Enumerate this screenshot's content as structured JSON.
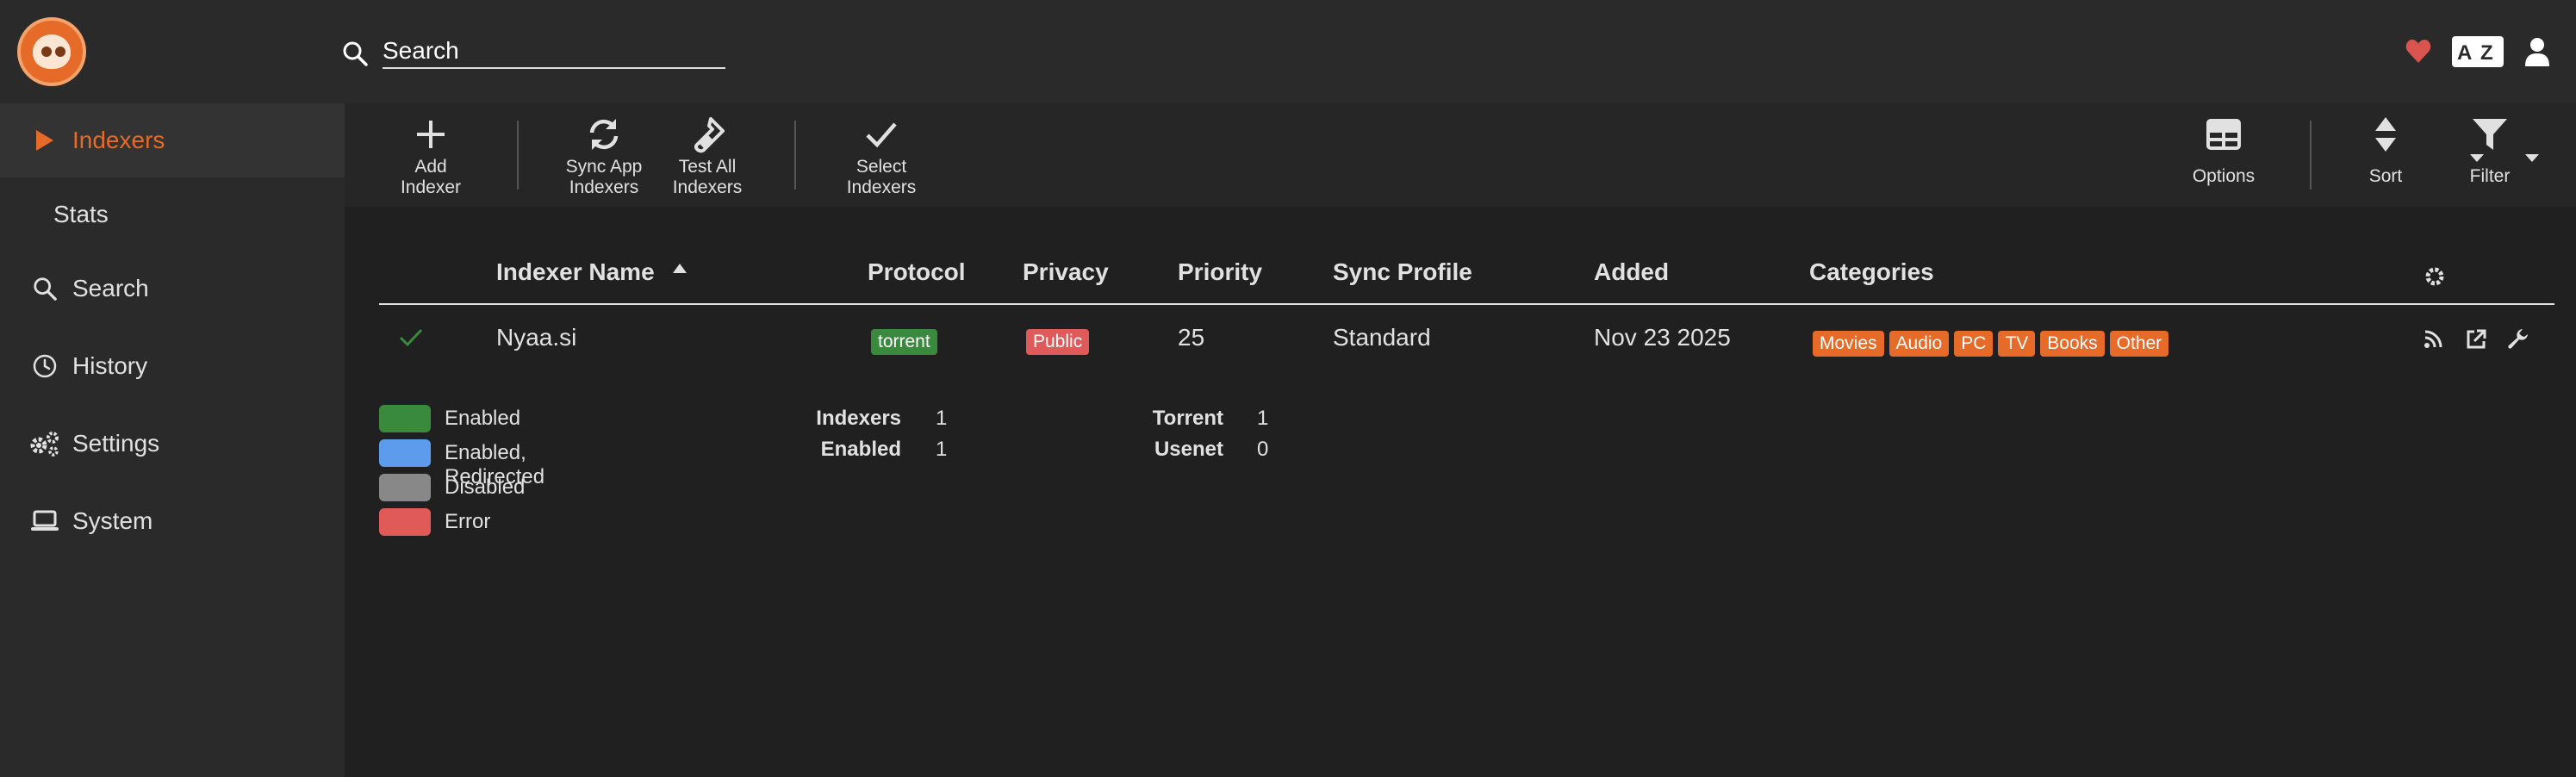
{
  "header": {
    "search_placeholder": "Search",
    "icons": [
      "heart-icon",
      "translate-icon",
      "user-icon"
    ],
    "heart_color": "#d9534f"
  },
  "sidebar": {
    "items": [
      {
        "label": "Indexers",
        "icon": "play-icon",
        "active": true
      },
      {
        "label": "Stats",
        "icon": "",
        "active": false
      },
      {
        "label": "Search",
        "icon": "search-icon",
        "active": false
      },
      {
        "label": "History",
        "icon": "clock-icon",
        "active": false
      },
      {
        "label": "Settings",
        "icon": "gears-icon",
        "active": false
      },
      {
        "label": "System",
        "icon": "laptop-icon",
        "active": false
      }
    ]
  },
  "toolbar": {
    "add_line1": "Add",
    "add_line2": "Indexer",
    "sync_line1": "Sync App",
    "sync_line2": "Indexers",
    "test_line1": "Test All",
    "test_line2": "Indexers",
    "select_line1": "Select",
    "select_line2": "Indexers",
    "options": "Options",
    "sort": "Sort",
    "filter": "Filter"
  },
  "table": {
    "columns": [
      "Indexer Name",
      "Protocol",
      "Privacy",
      "Priority",
      "Sync Profile",
      "Added",
      "Categories"
    ],
    "rows": [
      {
        "status": "enabled",
        "name": "Nyaa.si",
        "protocol": "torrent",
        "privacy": "Public",
        "priority": "25",
        "sync_profile": "Standard",
        "added": "Nov 23 2025",
        "categories": [
          "Movies",
          "Audio",
          "PC",
          "TV",
          "Books",
          "Other"
        ]
      }
    ]
  },
  "legend": [
    {
      "label": "Enabled",
      "color": "#3a8a3e"
    },
    {
      "label": "Enabled, Redirected",
      "color": "#5d9cec"
    },
    {
      "label": "Disabled",
      "color": "#888888"
    },
    {
      "label": "Error",
      "color": "#e05a5a"
    }
  ],
  "stats": {
    "indexers_label": "Indexers",
    "indexers_value": "1",
    "enabled_label": "Enabled",
    "enabled_value": "1",
    "torrent_label": "Torrent",
    "torrent_value": "1",
    "usenet_label": "Usenet",
    "usenet_value": "0"
  },
  "colors": {
    "accent": "#e66a28",
    "protocol_torrent": "#3a8a3e",
    "privacy_public": "#e05a5a",
    "category": "#e66a28"
  }
}
